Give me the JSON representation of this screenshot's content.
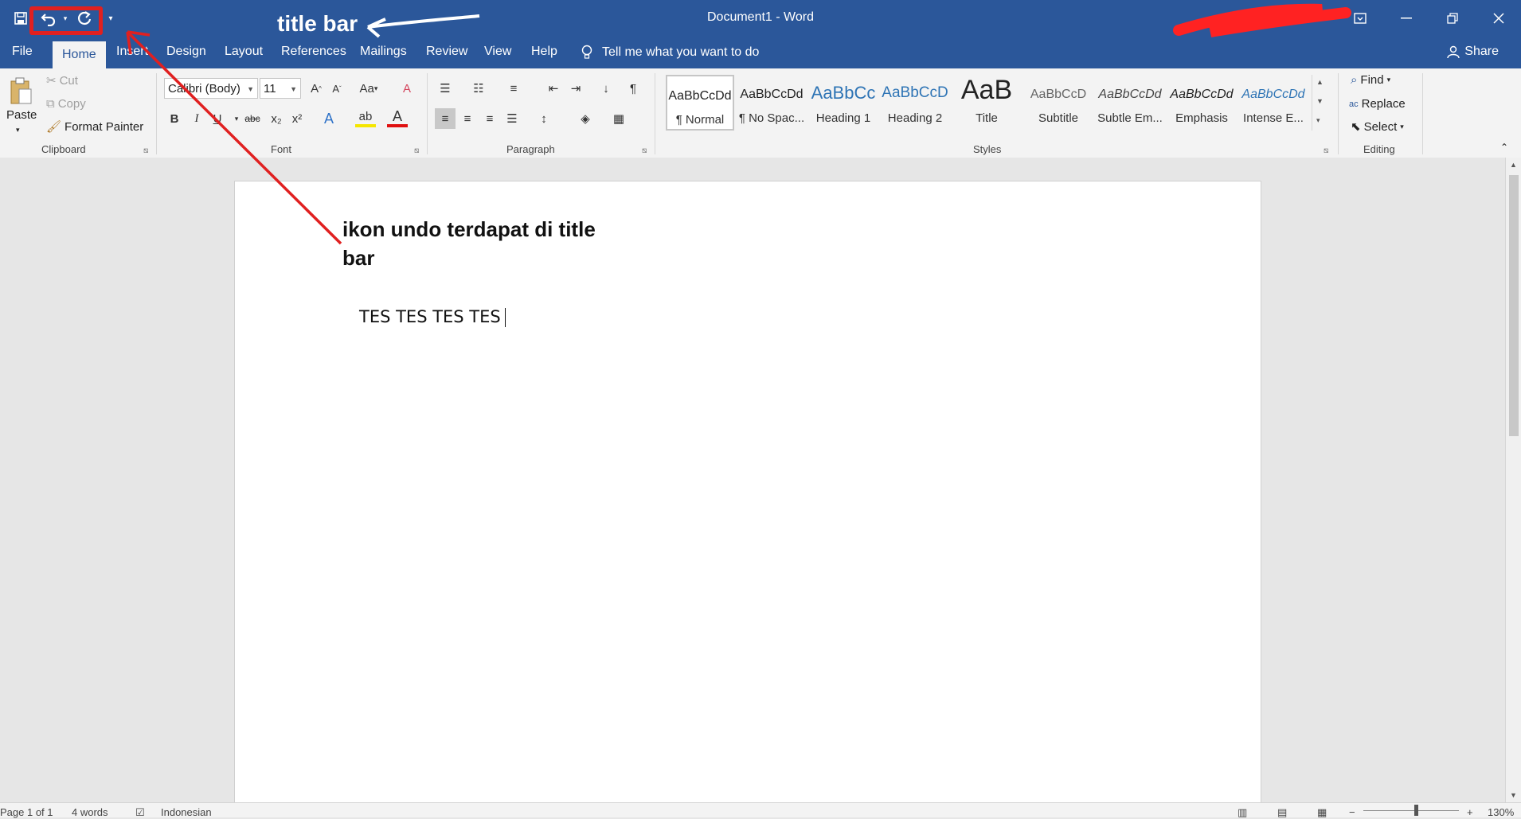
{
  "window": {
    "title": "Document1  -  Word"
  },
  "quick_access": {
    "save": "save-icon",
    "undo": "undo-icon",
    "redo": "redo-icon",
    "more": "▾"
  },
  "annotations": {
    "title_bar_label": "title bar",
    "undo_note": "ikon undo terdapat di title bar",
    "color": "#e02020"
  },
  "tabs": [
    "File",
    "Home",
    "Insert",
    "Design",
    "Layout",
    "References",
    "Mailings",
    "Review",
    "View",
    "Help"
  ],
  "active_tab": "Home",
  "tell_me": "Tell me what you want to do",
  "share": "Share",
  "ribbon": {
    "clipboard": {
      "label": "Clipboard",
      "paste": "Paste",
      "cut": "Cut",
      "copy": "Copy",
      "format_painter": "Format Painter"
    },
    "font": {
      "label": "Font",
      "font_name": "Calibri (Body)",
      "font_size": "11",
      "case": "Aa",
      "bold": "B",
      "italic": "I",
      "underline": "U",
      "strike": "abc",
      "subscript": "x₂",
      "superscript": "x²"
    },
    "paragraph": {
      "label": "Paragraph"
    },
    "styles": {
      "label": "Styles",
      "items": [
        {
          "preview": "AaBbCcDd",
          "name": "¶ Normal"
        },
        {
          "preview": "AaBbCcDd",
          "name": "¶ No Spac..."
        },
        {
          "preview": "AaBbCc",
          "name": "Heading 1"
        },
        {
          "preview": "AaBbCcD",
          "name": "Heading 2"
        },
        {
          "preview": "AaB",
          "name": "Title"
        },
        {
          "preview": "AaBbCcD",
          "name": "Subtitle"
        },
        {
          "preview": "AaBbCcDd",
          "name": "Subtle Em..."
        },
        {
          "preview": "AaBbCcDd",
          "name": "Emphasis"
        },
        {
          "preview": "AaBbCcDd",
          "name": "Intense E..."
        }
      ]
    },
    "editing": {
      "label": "Editing",
      "find": "Find",
      "replace": "Replace",
      "select": "Select"
    }
  },
  "document": {
    "text": "TES TES TES TES"
  },
  "status": {
    "page": "Page 1 of 1",
    "words": "4 words",
    "language": "Indonesian",
    "zoom": "130%",
    "zoom_minus": "−",
    "zoom_plus": "+"
  },
  "colors": {
    "accent": "#2b579a",
    "ribbon_bg": "#f3f3f3"
  }
}
